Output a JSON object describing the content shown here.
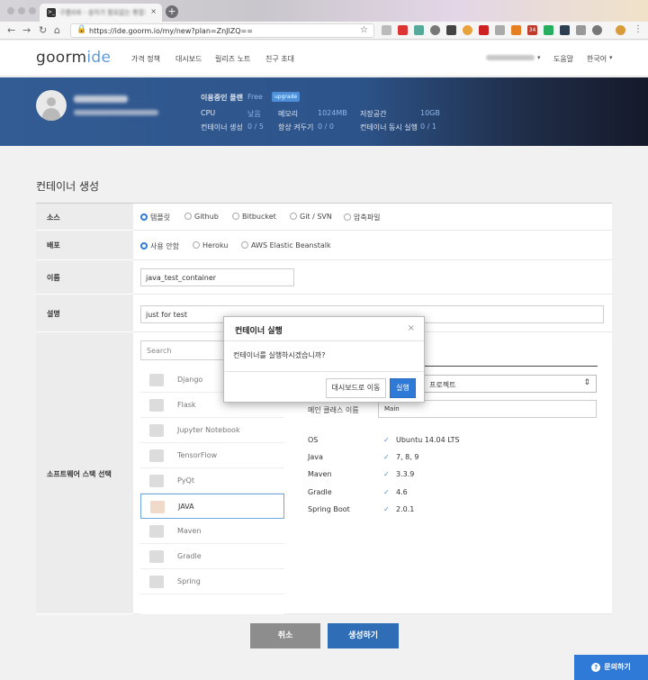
{
  "browser": {
    "tab_title": "구름IDE - 설치가 필요없는 통합개발환경",
    "url": "https://ide.goorm.io/my/new?plan=ZnJlZQ==",
    "tab_close": "×",
    "new_tab": "+",
    "back": "←",
    "forward": "→",
    "reload": "↻",
    "home": "⌂",
    "lock": "🔒",
    "star": "☆",
    "ext_badge": "34"
  },
  "header": {
    "logo_main": "goorm",
    "logo_accent": "ide",
    "nav": [
      "가격 정책",
      "대시보드",
      "릴리즈 노트",
      "친구 초대"
    ],
    "help": "도움말",
    "language": "한국어",
    "caret": "▾"
  },
  "plan": {
    "current_plan_label": "이용중인 플랜",
    "current_plan_value": "Free",
    "upgrade_label": "upgrade",
    "cpu_label": "CPU",
    "cpu_value": "낮음",
    "memory_label": "메모리",
    "memory_value": "1024MB",
    "storage_label": "저장공간",
    "storage_value": "10GB",
    "containers_label": "컨테이너 생성",
    "containers_value": "0 / 5",
    "always_on_label": "항상 켜두기",
    "always_on_value": "0 / 0",
    "concurrent_label": "컨테이너 동시 실행",
    "concurrent_value": "0 / 1"
  },
  "form": {
    "title": "컨테이너 생성",
    "source_label": "소스",
    "source_options": [
      "템플릿",
      "Github",
      "Bitbucket",
      "Git / SVN",
      "압축파일"
    ],
    "deploy_label": "배포",
    "deploy_options": [
      "사용 안함",
      "Heroku",
      "AWS Elastic Beanstalk"
    ],
    "name_label": "이름",
    "name_value": "java_test_container",
    "desc_label": "설명",
    "desc_value": "just for test",
    "stack_label": "소프트웨어 스택 선택",
    "search_placeholder": "Search",
    "stacks": [
      "Django",
      "Flask",
      "Jupyter Notebook",
      "TensorFlow",
      "PyQt",
      "JAVA",
      "Maven",
      "Gradle",
      "Spring"
    ],
    "selected_stack": "JAVA",
    "project_select": "프로젝트",
    "select_arrow": "⇕",
    "main_class_label": "메인 클래스 이름",
    "main_class_value": "Main",
    "check": "✓",
    "specs": [
      {
        "label": "OS",
        "value": "Ubuntu 14.04 LTS"
      },
      {
        "label": "Java",
        "value": "7, 8, 9"
      },
      {
        "label": "Maven",
        "value": "3.3.9"
      },
      {
        "label": "Gradle",
        "value": "4.6"
      },
      {
        "label": "Spring Boot",
        "value": "2.0.1"
      }
    ],
    "cancel": "취소",
    "create": "생성하기"
  },
  "modal": {
    "title": "컨테이너 실행",
    "close": "×",
    "message": "컨테이너를 실행하시겠습니까?",
    "dashboard_button": "대시보드로 이동",
    "run_button": "실행"
  },
  "help_button": "문의하기",
  "help_icon": "?"
}
